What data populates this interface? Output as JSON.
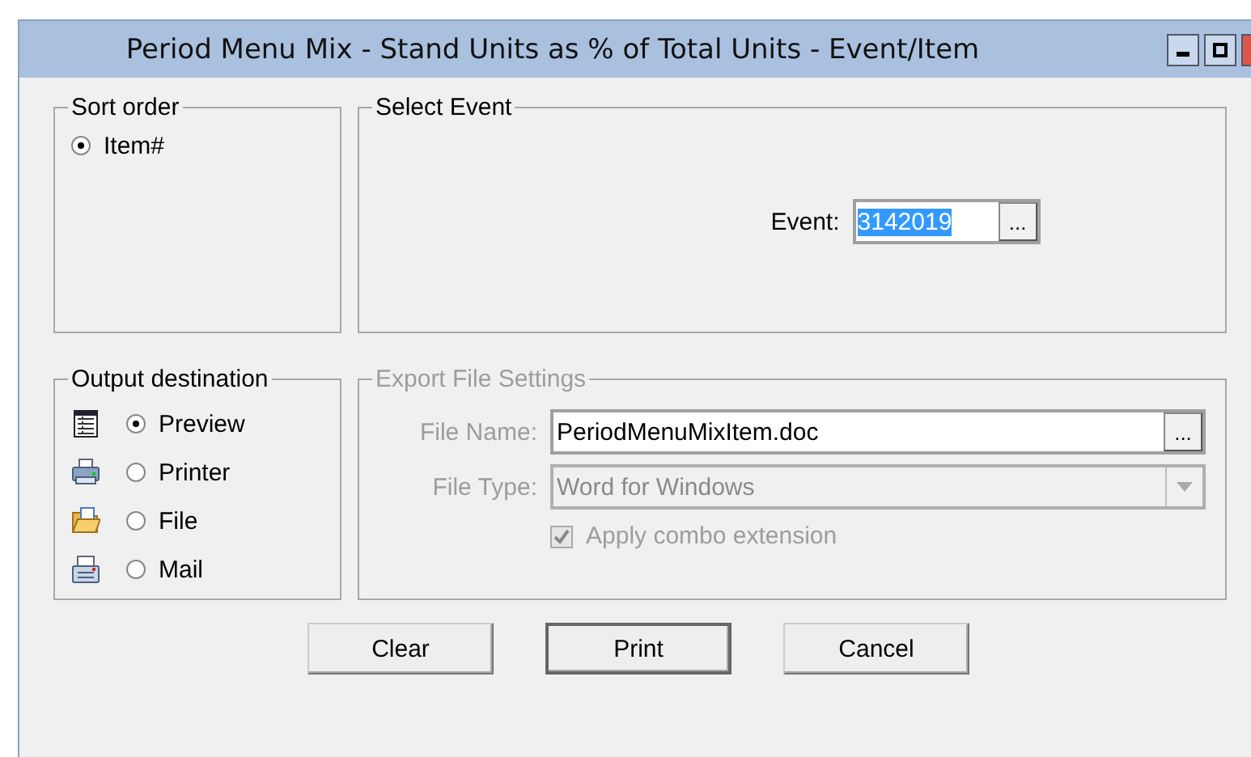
{
  "window": {
    "title": "Period Menu Mix - Stand Units as % of Total Units - Event/Item"
  },
  "sort_order": {
    "title": "Sort order",
    "options": [
      {
        "label": "Item#",
        "selected": true
      }
    ]
  },
  "select_event": {
    "title": "Select Event",
    "event_label": "Event:",
    "event_value": "3142019",
    "value_selected": true,
    "browse_label": "..."
  },
  "output_destination": {
    "title": "Output destination",
    "options": [
      {
        "label": "Preview",
        "kind": "preview",
        "selected": true
      },
      {
        "label": "Printer",
        "kind": "printer",
        "selected": false
      },
      {
        "label": "File",
        "kind": "file",
        "selected": false
      },
      {
        "label": "Mail",
        "kind": "mail",
        "selected": false
      }
    ]
  },
  "export_settings": {
    "title": "Export File Settings",
    "disabled": true,
    "file_name_label": "File Name:",
    "file_name": "PeriodMenuMixItem.doc",
    "browse_label": "...",
    "file_type_label": "File Type:",
    "file_type": "Word for Windows",
    "apply_combo": {
      "label": "Apply combo extension",
      "checked": true
    }
  },
  "buttons": [
    {
      "label": "Clear",
      "default": false
    },
    {
      "label": "Print",
      "default": true
    },
    {
      "label": "Cancel",
      "default": false
    }
  ]
}
